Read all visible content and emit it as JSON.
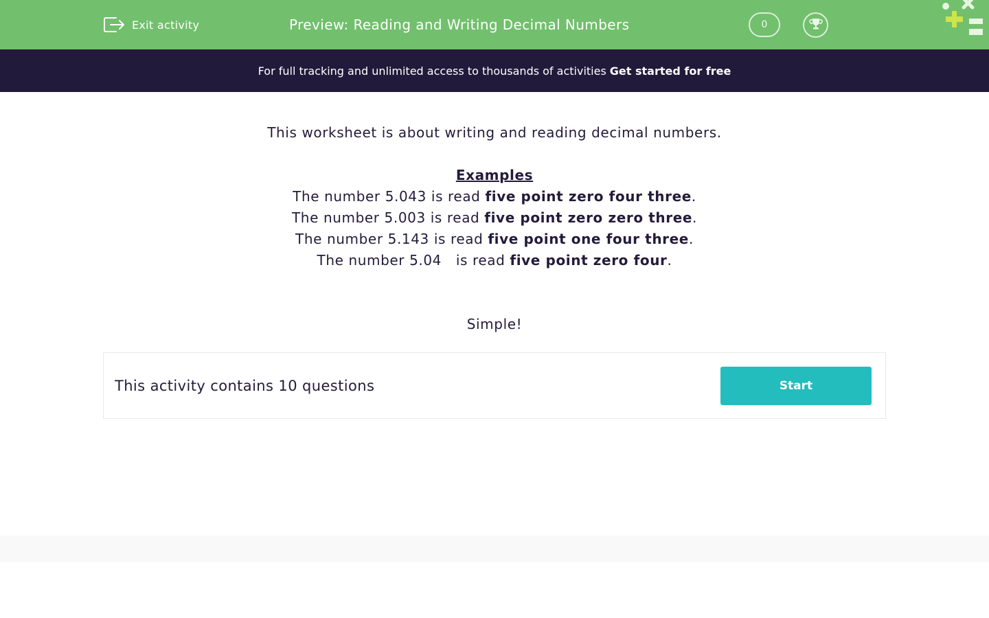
{
  "header": {
    "exit_label": "Exit activity",
    "title": "Preview: Reading and Writing Decimal Numbers",
    "score": "0",
    "exit_icon": "exit-icon",
    "trophy_icon": "trophy-icon",
    "bg_color": "#72bf6d"
  },
  "promo": {
    "text": "For full tracking and unlimited access to thousands of activities",
    "link": "Get started for free",
    "bg_color": "#221a3b"
  },
  "content": {
    "intro": "This worksheet is about writing and reading decimal numbers.",
    "examples_heading": "Examples",
    "examples": [
      {
        "prefix": "The number 5.043 is read ",
        "reading": "five point zero four three",
        "suffix": "."
      },
      {
        "prefix": "The number 5.003 is read ",
        "reading": "five point zero zero three",
        "suffix": "."
      },
      {
        "prefix": "The number 5.143 is read ",
        "reading": "five point one four three",
        "suffix": "."
      },
      {
        "prefix": "The number 5.04   is read ",
        "reading": "five point zero four",
        "suffix": "."
      }
    ],
    "closing": "Simple!"
  },
  "activity": {
    "summary": "This activity contains 10 questions",
    "start_label": "Start",
    "accent_color": "#23bdbe"
  }
}
